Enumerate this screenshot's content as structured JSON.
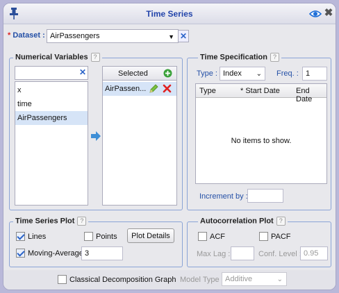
{
  "window": {
    "title": "Time Series"
  },
  "dataset": {
    "required_mark": "*",
    "label": "Dataset :",
    "value": "AirPassengers"
  },
  "numerical_variables": {
    "title": "Numerical Variables",
    "help": "?",
    "search_value": "",
    "items": [
      "x",
      "time",
      "AirPassengers"
    ],
    "selected_header": "Selected",
    "selected_items": [
      "AirPassen..."
    ]
  },
  "time_spec": {
    "title": "Time Specification",
    "help": "?",
    "type_label": "Type :",
    "type_value": "Index",
    "freq_label": "Freq. :",
    "freq_value": "1",
    "columns": [
      "Type",
      "* Start Date",
      "End Date"
    ],
    "empty_text": "No items to show.",
    "increment_label": "Increment by :",
    "increment_value": ""
  },
  "ts_plot": {
    "title": "Time Series Plot",
    "help": "?",
    "lines_label": "Lines",
    "lines_checked": true,
    "points_label": "Points",
    "points_checked": false,
    "plot_details_label": "Plot Details",
    "ma_label": "Moving-Average",
    "ma_checked": true,
    "ma_value": "3"
  },
  "acf_plot": {
    "title": "Autocorrelation Plot",
    "help": "?",
    "acf_label": "ACF",
    "pacf_label": "PACF",
    "maxlag_label": "Max Lag :",
    "maxlag_value": "",
    "conf_label": "Conf. Level :",
    "conf_value": "0.95"
  },
  "bottom": {
    "decomp_label": "Classical Decomposition Graph",
    "model_type_label": "Model Type :",
    "model_type_value": "Additive"
  }
}
